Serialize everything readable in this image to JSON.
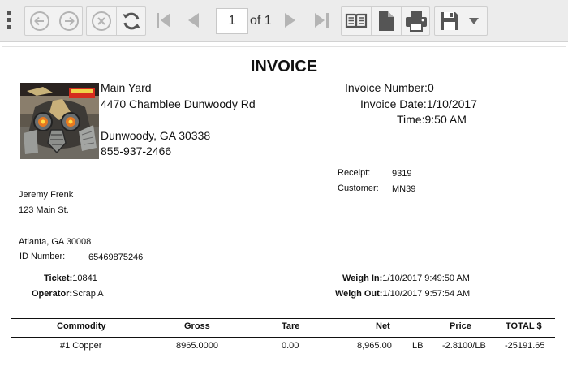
{
  "toolbar": {
    "current_page": "1",
    "page_of": "of 1"
  },
  "invoice": {
    "title": "INVOICE",
    "company": {
      "name": "Main Yard",
      "address1": "4470 Chamblee Dunwoody Rd",
      "city_state_zip": "Dunwoody, GA 30338",
      "phone": "855-937-2466"
    },
    "number_label": "Invoice Number:",
    "number_value": "0",
    "date_label": "Invoice Date:",
    "date_value": "1/10/2017",
    "time_label": "Time:",
    "time_value": "9:50 AM",
    "receipt_label": "Receipt:",
    "receipt_value": "9319",
    "customer_label": "Customer:",
    "customer_value": "MN39",
    "customer": {
      "name": "Jeremy Frenk",
      "address1": "123 Main St.",
      "city_state_zip": "Atlanta, GA 30008",
      "id_label": "ID Number:",
      "id_value": "65469875246"
    },
    "ticket_label": "Ticket:",
    "ticket_value": "10841",
    "operator_label": "Operator:",
    "operator_value": "Scrap A",
    "weigh_in_label": "Weigh In:",
    "weigh_in_value": "1/10/2017 9:49:50 AM",
    "weigh_out_label": "Weigh Out:",
    "weigh_out_value": "1/10/2017 9:57:54 AM"
  },
  "table": {
    "headers": {
      "commodity": "Commodity",
      "gross": "Gross",
      "tare": "Tare",
      "net": "Net",
      "price": "Price",
      "total": "TOTAL $"
    },
    "rows": [
      {
        "commodity": "#1 Copper",
        "gross": "8965.0000",
        "tare": "0.00",
        "net": "8,965.00",
        "unit": "LB",
        "price": "-2.8100/LB",
        "total": "-25191.65"
      }
    ]
  }
}
